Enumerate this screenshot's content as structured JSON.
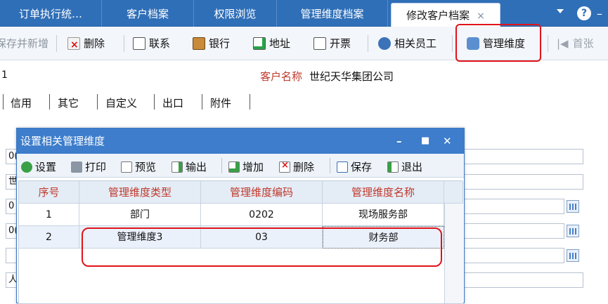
{
  "tabs": [
    {
      "label": "订单执行统…"
    },
    {
      "label": "客户档案"
    },
    {
      "label": "权限浏览"
    },
    {
      "label": "管理维度档案"
    },
    {
      "label": "修改客户档案"
    }
  ],
  "tab_close": "×",
  "help": "?",
  "toolbar": {
    "save_new": "保存并新增",
    "delete": "删除",
    "contact": "联系",
    "bank": "银行",
    "address": "地址",
    "invoice": "开票",
    "staff": "相关员工",
    "mgmt_dim": "管理维度",
    "first": "首张"
  },
  "form": {
    "row_no": "1",
    "customer_label": "客户名称",
    "customer_name": "世纪天华集团公司",
    "subtabs": [
      "信用",
      "其它",
      "自定义",
      "出口",
      "附件"
    ],
    "field_prefixes": [
      "0(",
      "世",
      "0",
      "0(",
      "",
      "人"
    ]
  },
  "dialog": {
    "title": "设置相关管理维度",
    "buttons": {
      "settings": "设置",
      "print": "打印",
      "preview": "预览",
      "export": "输出",
      "add": "增加",
      "delete": "删除",
      "save": "保存",
      "exit": "退出"
    },
    "columns": [
      "序号",
      "管理维度类型",
      "管理维度编码",
      "管理维度名称"
    ],
    "rows": [
      {
        "no": "1",
        "type": "部门",
        "code": "0202",
        "name": "现场服务部"
      },
      {
        "no": "2",
        "type": "管理维度3",
        "code": "03",
        "name": "财务部"
      }
    ]
  },
  "colors": {
    "accent": "#2f6fb8",
    "highlight": "#e0141b",
    "label_red": "#c0392b"
  }
}
